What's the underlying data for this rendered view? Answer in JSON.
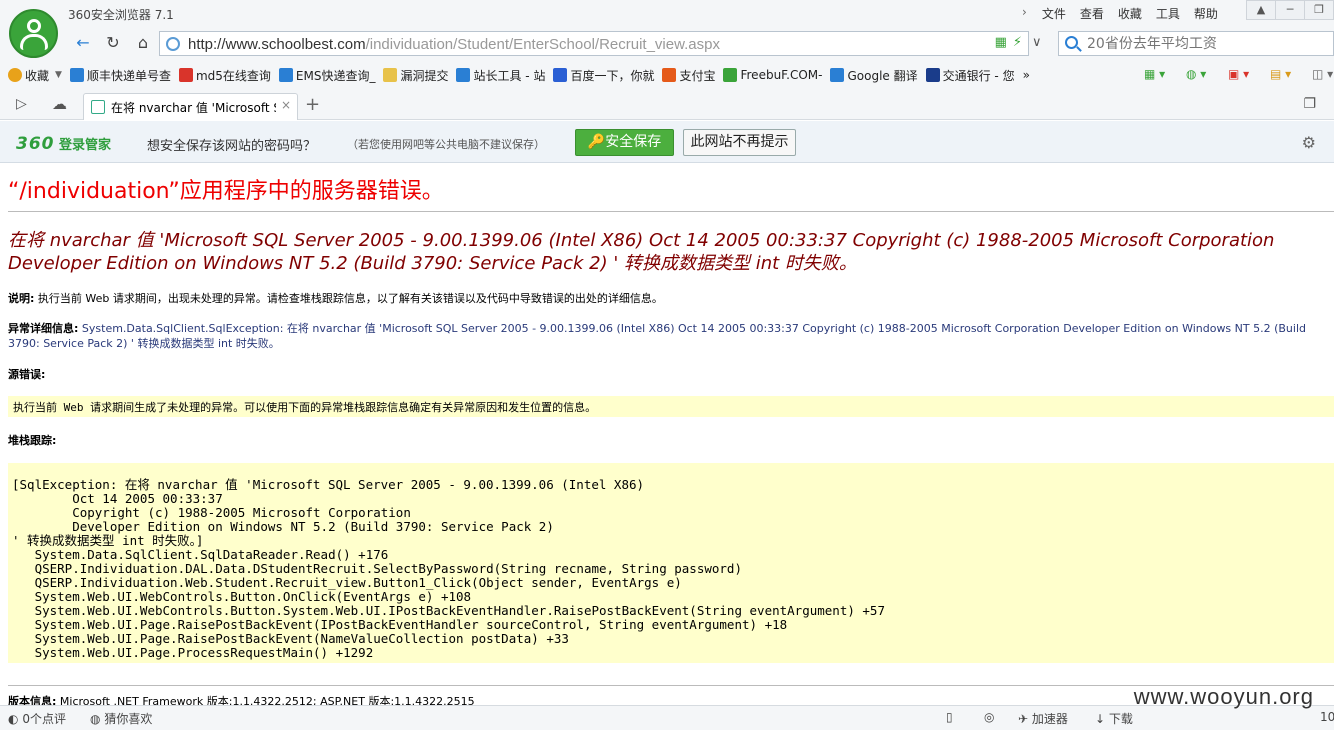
{
  "browser": {
    "app_title": "360安全浏览器 7.1",
    "menu": [
      "文件",
      "查看",
      "收藏",
      "工具",
      "帮助"
    ],
    "window_controls": [
      "shirt-icon",
      "minimize-icon",
      "restore-icon"
    ]
  },
  "address": {
    "url_host": "http://www.schoolbest.com",
    "url_path": "/individuation/Student/EnterSchool/Recruit_view.aspx",
    "search_placeholder": "20省份去年平均工资"
  },
  "bookmarks": {
    "items": [
      {
        "label": "收藏",
        "icon": "star-icon",
        "color": "#e8a21a"
      },
      {
        "label": "顺丰快递单号查",
        "icon": "ie-icon",
        "color": "#2a7fd4"
      },
      {
        "label": "md5在线查询",
        "icon": "grid-icon",
        "color": "#d9342b"
      },
      {
        "label": "EMS快递查询_",
        "icon": "ie-icon",
        "color": "#2a7fd4"
      },
      {
        "label": "漏洞提交",
        "icon": "folder-icon",
        "color": "#e8c24a"
      },
      {
        "label": "站长工具 - 站",
        "icon": "chart-icon",
        "color": "#2a7fd4"
      },
      {
        "label": "百度一下，你就",
        "icon": "paw-icon",
        "color": "#2a5fd4"
      },
      {
        "label": "支付宝",
        "icon": "alipay-icon",
        "color": "#e55a1a"
      },
      {
        "label": "FreebuF.COM-",
        "icon": "f-icon",
        "color": "#3aa43a"
      },
      {
        "label": "Google 翻译",
        "icon": "translate-icon",
        "color": "#2a7fd4"
      },
      {
        "label": "交通银行 - 您",
        "icon": "bank-icon",
        "color": "#1a3c8a"
      }
    ],
    "more": "»"
  },
  "tab": {
    "title": "在将 nvarchar 值 'Microsoft SQ",
    "close": "×",
    "new": "+"
  },
  "password_bar": {
    "brand_num": "360",
    "brand_text": "登录管家",
    "message": "想安全保存该网站的密码吗？",
    "note": "（若您使用网吧等公共电脑不建议保存）",
    "save": "安全保存",
    "never": "此网站不再提示"
  },
  "error": {
    "title": "“/individuation”应用程序中的服务器错误。",
    "subtitle": "在将 nvarchar 值 'Microsoft SQL Server 2005 - 9.00.1399.06 (Intel X86) Oct 14 2005 00:33:37 Copyright (c) 1988-2005 Microsoft Corporation Developer Edition on Windows NT 5.2 (Build 3790: Service Pack 2) ' 转换成数据类型 int 时失败。",
    "desc_label": "说明:",
    "desc_text": " 执行当前 Web 请求期间，出现未处理的异常。请检查堆栈跟踪信息，以了解有关该错误以及代码中导致错误的出处的详细信息。",
    "exc_label": "异常详细信息:",
    "exc_text": " System.Data.SqlClient.SqlException: 在将 nvarchar 值 'Microsoft SQL Server 2005 - 9.00.1399.06 (Intel X86) Oct 14 2005 00:33:37 Copyright (c) 1988-2005 Microsoft Corporation Developer Edition on Windows NT 5.2 (Build 3790: Service Pack 2) ' 转换成数据类型 int 时失败。",
    "source_label": "源错误:",
    "source_text": "执行当前 Web 请求期间生成了未处理的异常。可以使用下面的异常堆栈跟踪信息确定有关异常原因和发生位置的信息。",
    "stack_label": "堆栈跟踪:",
    "stack_trace": "[SqlException: 在将 nvarchar 值 'Microsoft SQL Server 2005 - 9.00.1399.06 (Intel X86)\n        Oct 14 2005 00:33:37\n        Copyright (c) 1988-2005 Microsoft Corporation\n        Developer Edition on Windows NT 5.2 (Build 3790: Service Pack 2)\n' 转换成数据类型 int 时失败。]\n   System.Data.SqlClient.SqlDataReader.Read() +176\n   QSERP.Individuation.DAL.Data.DStudentRecruit.SelectByPassword(String recname, String password)\n   QSERP.Individuation.Web.Student.Recruit_view.Button1_Click(Object sender, EventArgs e)\n   System.Web.UI.WebControls.Button.OnClick(EventArgs e) +108\n   System.Web.UI.WebControls.Button.System.Web.UI.IPostBackEventHandler.RaisePostBackEvent(String eventArgument) +57\n   System.Web.UI.Page.RaisePostBackEvent(IPostBackEventHandler sourceControl, String eventArgument) +18\n   System.Web.UI.Page.RaisePostBackEvent(NameValueCollection postData) +33\n   System.Web.UI.Page.ProcessRequestMain() +1292",
    "version_label": "版本信息:",
    "version_text": " Microsoft .NET Framework 版本:1.1.4322.2512; ASP.NET 版本:1.1.4322.2515"
  },
  "status": {
    "comments": "0个点评",
    "guess": "猜你喜欢",
    "accelerator": "加速器",
    "download": "下载",
    "zoom": "10"
  },
  "watermark": "www.wooyun.org"
}
